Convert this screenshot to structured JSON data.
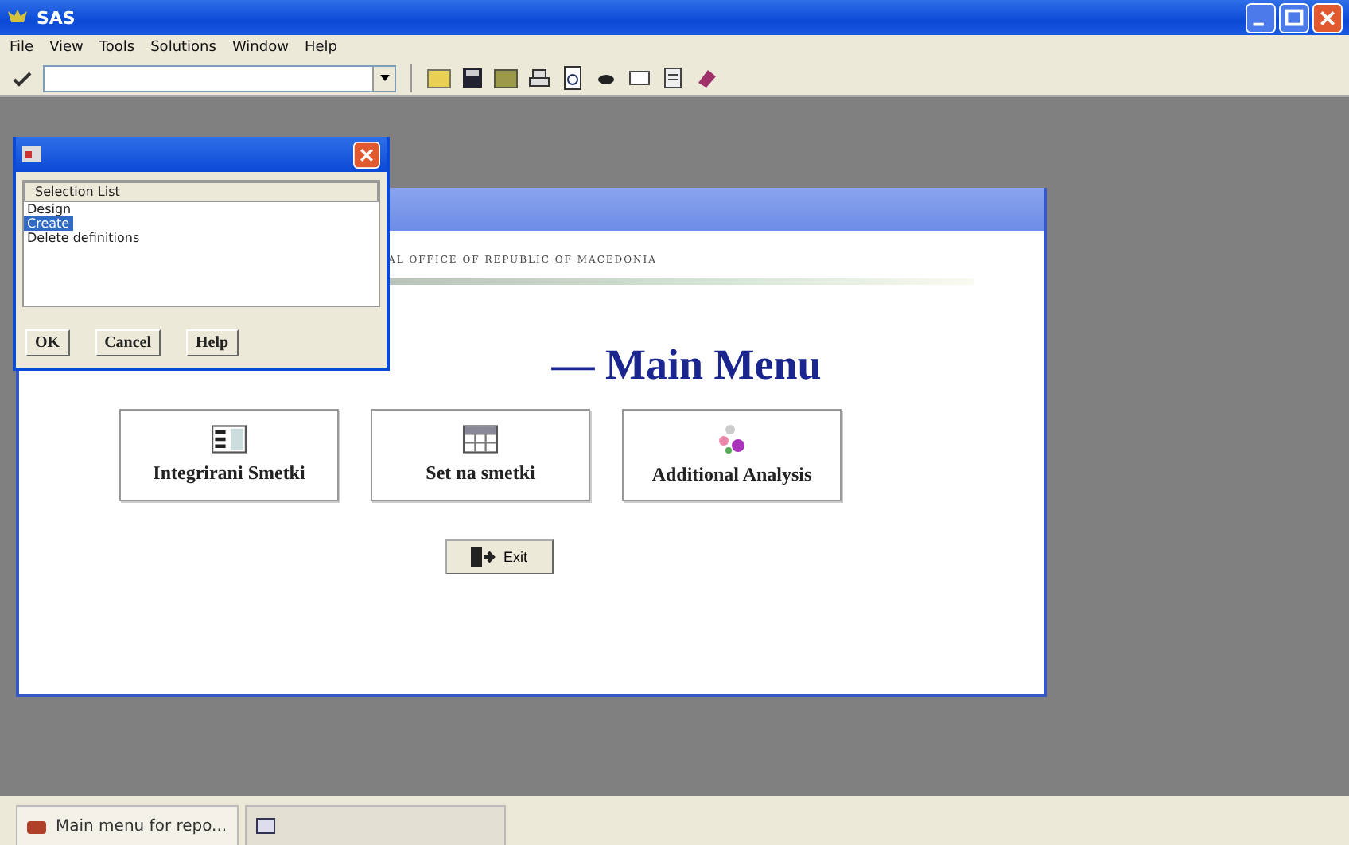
{
  "window": {
    "title": "SAS"
  },
  "menu": [
    "File",
    "View",
    "Tools",
    "Solutions",
    "Window",
    "Help"
  ],
  "report_window": {
    "header": "AL OFFICE OF REPUBLIC OF MACEDONIA",
    "heading": "— Main Menu",
    "buttons": [
      {
        "label": "Integrirani Smetki",
        "kind": "list"
      },
      {
        "label": "Set na smetki",
        "kind": "grid"
      },
      {
        "label": "Additional Analysis",
        "kind": "analysis"
      }
    ],
    "exit": "Exit"
  },
  "dialog": {
    "header": "Selection List",
    "items": [
      {
        "label": "Design",
        "selected": false
      },
      {
        "label": "Create",
        "selected": true
      },
      {
        "label": "Delete definitions",
        "selected": false
      }
    ],
    "buttons": [
      "OK",
      "Cancel",
      "Help"
    ]
  },
  "taskbar": [
    {
      "kind": "task",
      "label": "Main menu for repo...",
      "selected": true
    },
    {
      "kind": "blank",
      "selected": false
    }
  ]
}
